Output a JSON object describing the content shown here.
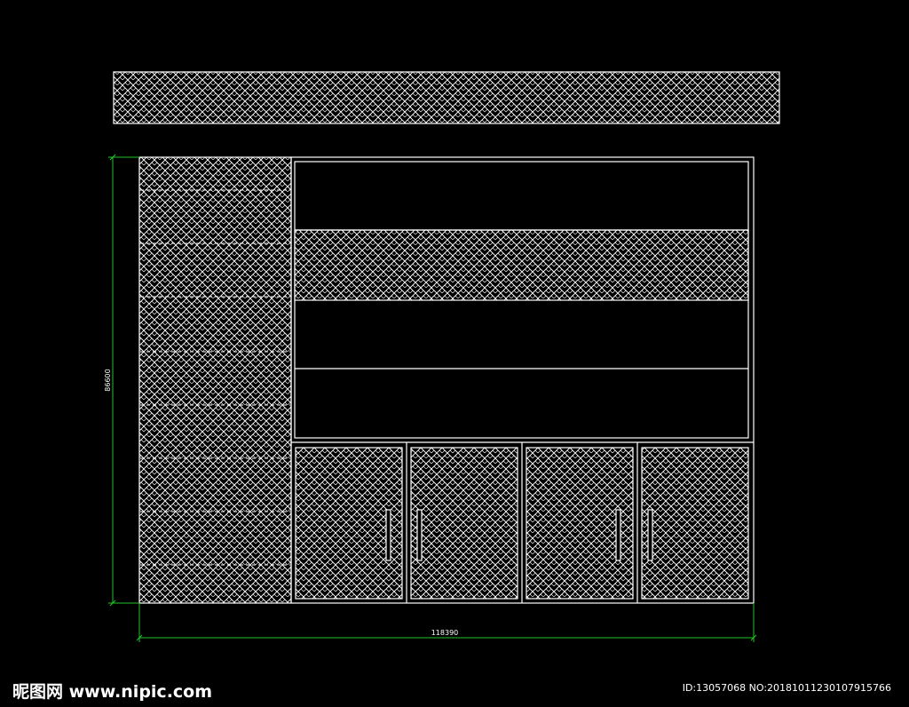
{
  "drawing": {
    "height_dimension": "86600",
    "width_dimension": "118390",
    "colors": {
      "background": "#000000",
      "lines": "#ffffff",
      "dimension_lines": "#22c42a"
    },
    "hatch_pattern": "herringbone"
  },
  "watermark": {
    "site": "昵图网 www.nipic.com",
    "id_text": "ID:13057068 NO:20181011230107915766"
  }
}
